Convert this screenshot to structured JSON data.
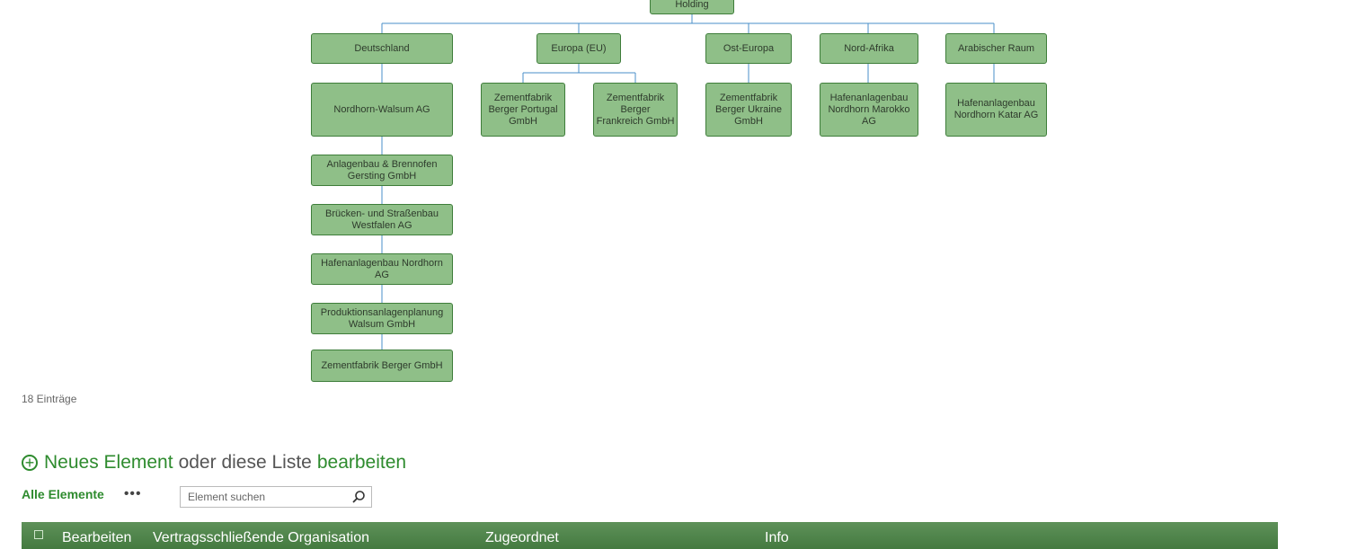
{
  "org_chart": {
    "root": "Holding",
    "regions": [
      {
        "label": "Deutschland",
        "children": [
          "Nordhorn-Walsum AG",
          "Anlagenbau & Brennofen Gersting GmbH",
          "Brücken- und Straßenbau Westfalen AG",
          "Hafenanlagenbau Nordhorn AG",
          "Produktionsanlagenplanung Walsum GmbH",
          "Zementfabrik Berger GmbH"
        ]
      },
      {
        "label": "Europa (EU)",
        "children": [
          "Zementfabrik Berger Portugal GmbH",
          "Zementfabrik Berger Frankreich GmbH"
        ]
      },
      {
        "label": "Ost-Europa",
        "children": [
          "Zementfabrik Berger Ukraine GmbH"
        ]
      },
      {
        "label": "Nord-Afrika",
        "children": [
          "Hafenanlagenbau Nordhorn Marokko AG"
        ]
      },
      {
        "label": "Arabischer Raum",
        "children": [
          "Hafenanlagenbau Nordhorn Katar AG"
        ]
      }
    ]
  },
  "list": {
    "count_text": "18 Einträge",
    "new_item_label": "Neues Element",
    "or_text": "oder diese Liste",
    "edit_label": "bearbeiten",
    "view_label": "Alle Elemente",
    "more_label": "•••",
    "search": {
      "placeholder": "Element suchen",
      "value": ""
    },
    "columns": [
      "Bearbeiten",
      "Vertragsschließende Organisation",
      "Zugeordnet",
      "Info"
    ]
  },
  "colors": {
    "accent": "#2e8b2e",
    "node_fill": "#8fbf88",
    "node_border": "#3e7d3a",
    "connector": "#4a8fc9"
  }
}
